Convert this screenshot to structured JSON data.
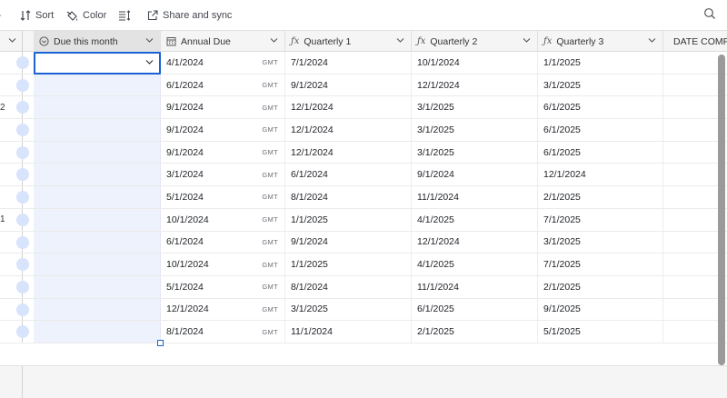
{
  "toolbar": {
    "sort_label": "Sort",
    "color_label": "Color",
    "share_label": "Share and sync"
  },
  "columns": {
    "due": "Due this month",
    "annual": "Annual Due",
    "q1": "Quarterly 1",
    "q2": "Quarterly 2",
    "q3": "Quarterly 3",
    "date_completed": "DATE COMPL"
  },
  "timezone_label": "GMT",
  "colors": {
    "accent": "#1a62d6",
    "selected_column_bg": "#eef2fd",
    "header_bg": "#f5f5f5"
  },
  "rows": [
    {
      "stub": "",
      "annual": "4/1/2024",
      "q1": "7/1/2024",
      "q2": "10/1/2024",
      "q3": "1/1/2025"
    },
    {
      "stub": "",
      "annual": "6/1/2024",
      "q1": "9/1/2024",
      "q2": "12/1/2024",
      "q3": "3/1/2025"
    },
    {
      "stub": "2",
      "annual": "9/1/2024",
      "q1": "12/1/2024",
      "q2": "3/1/2025",
      "q3": "6/1/2025"
    },
    {
      "stub": "",
      "annual": "9/1/2024",
      "q1": "12/1/2024",
      "q2": "3/1/2025",
      "q3": "6/1/2025"
    },
    {
      "stub": "",
      "annual": "9/1/2024",
      "q1": "12/1/2024",
      "q2": "3/1/2025",
      "q3": "6/1/2025"
    },
    {
      "stub": "",
      "annual": "3/1/2024",
      "q1": "6/1/2024",
      "q2": "9/1/2024",
      "q3": "12/1/2024"
    },
    {
      "stub": "",
      "annual": "5/1/2024",
      "q1": "8/1/2024",
      "q2": "11/1/2024",
      "q3": "2/1/2025"
    },
    {
      "stub": "1",
      "annual": "10/1/2024",
      "q1": "1/1/2025",
      "q2": "4/1/2025",
      "q3": "7/1/2025"
    },
    {
      "stub": "",
      "annual": "6/1/2024",
      "q1": "9/1/2024",
      "q2": "12/1/2024",
      "q3": "3/1/2025"
    },
    {
      "stub": "",
      "annual": "10/1/2024",
      "q1": "1/1/2025",
      "q2": "4/1/2025",
      "q3": "7/1/2025"
    },
    {
      "stub": "",
      "annual": "5/1/2024",
      "q1": "8/1/2024",
      "q2": "11/1/2024",
      "q3": "2/1/2025"
    },
    {
      "stub": "",
      "annual": "12/1/2024",
      "q1": "3/1/2025",
      "q2": "6/1/2025",
      "q3": "9/1/2025"
    },
    {
      "stub": "",
      "annual": "8/1/2024",
      "q1": "11/1/2024",
      "q2": "2/1/2025",
      "q3": "5/1/2025"
    }
  ]
}
